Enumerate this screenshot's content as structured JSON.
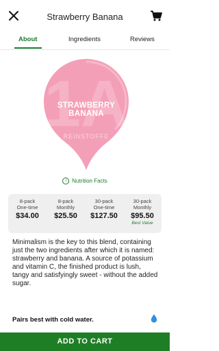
{
  "header": {
    "title": "Strawberry Banana",
    "close_icon": "close-icon",
    "cart_icon": "cart-icon"
  },
  "tabs": [
    {
      "label": "About",
      "active": true
    },
    {
      "label": "Ingredients",
      "active": false
    },
    {
      "label": "Reviews",
      "active": false
    }
  ],
  "product": {
    "capsule_title_line1": "STRAWBERRY",
    "capsule_title_line2": "BANANA",
    "brand": "REINSTOFFE",
    "watermark": "1A",
    "capsule_color": "#f49fb8"
  },
  "nutrition": {
    "label": "Nutrition Facts",
    "icon": "info-icon"
  },
  "pricing": [
    {
      "pack": "8-pack",
      "type": "One-time",
      "price": "$34.00",
      "badge": ""
    },
    {
      "pack": "8-pack",
      "type": "Monthly",
      "price": "$25.50",
      "badge": ""
    },
    {
      "pack": "30-pack",
      "type": "One-time",
      "price": "$127.50",
      "badge": ""
    },
    {
      "pack": "30-pack",
      "type": "Monthly",
      "price": "$95.50",
      "badge": "Best Value"
    }
  ],
  "description": "Minimalism is the key to this blend, containing just the two ingredients after which it is named: strawberry and banana. A source of potassium and vitamin C, the finished product is lush, tangy and satisfyingly sweet - without the added sugar.",
  "pairs": {
    "text": "Pairs best with cold water.",
    "icon": "water-drop-icon"
  },
  "cta": {
    "label": "ADD TO CART"
  },
  "colors": {
    "accent": "#1f7a2e",
    "button": "#1e7e26"
  }
}
